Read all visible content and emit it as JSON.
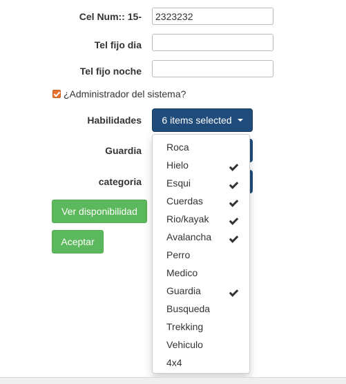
{
  "form": {
    "cel_label": "Cel Num:: 15-",
    "cel_value": "2323232",
    "tel_dia_label": "Tel fijo dia",
    "tel_dia_value": "",
    "tel_noche_label": "Tel fijo noche",
    "tel_noche_value": "",
    "admin_label": "¿Administrador del sistema?",
    "admin_checked": true,
    "habilidades_label": "Habilidades",
    "habilidades_button": "6 items selected",
    "guardia_label": "Guardia",
    "categoria_label": "categoria",
    "ver_button": "Ver disponibilidad",
    "aceptar_button": "Aceptar"
  },
  "dropdown": {
    "items": [
      {
        "label": "Roca",
        "selected": false
      },
      {
        "label": "Hielo",
        "selected": true
      },
      {
        "label": "Esqui",
        "selected": true
      },
      {
        "label": "Cuerdas",
        "selected": true
      },
      {
        "label": "Rio/kayak",
        "selected": true
      },
      {
        "label": "Avalancha",
        "selected": true
      },
      {
        "label": "Perro",
        "selected": false
      },
      {
        "label": "Medico",
        "selected": false
      },
      {
        "label": "Guardia",
        "selected": true
      },
      {
        "label": "Busqueda",
        "selected": false
      },
      {
        "label": "Trekking",
        "selected": false
      },
      {
        "label": "Vehiculo",
        "selected": false
      },
      {
        "label": "4x4",
        "selected": false
      }
    ]
  },
  "colors": {
    "accent_blue": "#1f4c7a",
    "success_green": "#5cb85c",
    "checkbox_orange": "#e8732c"
  }
}
